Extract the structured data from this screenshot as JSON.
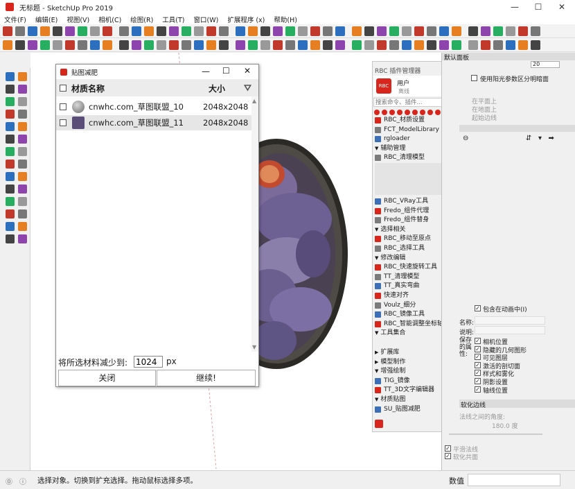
{
  "window": {
    "title": "无标题 - SketchUp Pro 2019",
    "minimize": "—",
    "maximize": "☐",
    "close": "✕"
  },
  "menu": [
    "文件(F)",
    "编辑(E)",
    "视图(V)",
    "相机(C)",
    "绘图(R)",
    "工具(T)",
    "窗口(W)",
    "扩展程序 (x)",
    "帮助(H)"
  ],
  "dialog": {
    "title": "贴图减肥",
    "col_name": "材质名称",
    "col_size": "大小",
    "rows": [
      {
        "name": "cnwhc.com_草图联盟_10",
        "size": "2048x2048"
      },
      {
        "name": "cnwhc.com_草图联盟_11",
        "size": "2048x2048"
      }
    ],
    "reduce_label": "将所选材料减少到:",
    "reduce_value": "1024",
    "unit": "px",
    "close_btn": "关闭",
    "continue_btn": "继续!"
  },
  "rbc": {
    "title": "RBC 插件管理器",
    "user": "用户",
    "user_sub": "离线",
    "search_placeholder": "搜索命令、插件...",
    "items": [
      {
        "label": "RBC_材质设置",
        "kind": "item"
      },
      {
        "label": "FCT_ModelLibrary",
        "kind": "item"
      },
      {
        "label": "rgloader",
        "kind": "item"
      },
      {
        "label": "辅助管理",
        "kind": "section"
      },
      {
        "label": "RBC_清理模型",
        "kind": "item"
      },
      {
        "label": "RBC_VRay工具",
        "kind": "item"
      },
      {
        "label": "Fredo_组件代理",
        "kind": "item"
      },
      {
        "label": "Fredo_组件替身",
        "kind": "item"
      },
      {
        "label": "选择相关",
        "kind": "section"
      },
      {
        "label": "RBC_移动至原点",
        "kind": "item"
      },
      {
        "label": "RBC_选择工具",
        "kind": "item"
      },
      {
        "label": "修改编辑",
        "kind": "section"
      },
      {
        "label": "RBC_快速旋转工具",
        "kind": "item"
      },
      {
        "label": "TT_清理模型",
        "kind": "item"
      },
      {
        "label": "TT_真实弯曲",
        "kind": "item"
      },
      {
        "label": "快速对齐",
        "kind": "item"
      },
      {
        "label": "Voulz_细分",
        "kind": "item"
      },
      {
        "label": "RBC_镜像工具",
        "kind": "item"
      },
      {
        "label": "RBC_智能调整坐标轴...",
        "kind": "item"
      },
      {
        "label": "工具集合",
        "kind": "section"
      },
      {
        "label": "扩展库",
        "kind": "collapsed"
      },
      {
        "label": "模型制作",
        "kind": "collapsed"
      },
      {
        "label": "增强绘制",
        "kind": "section"
      },
      {
        "label": "TIG_镜像",
        "kind": "item"
      },
      {
        "label": "TT_3D文字编辑器",
        "kind": "item"
      },
      {
        "label": "材质贴图",
        "kind": "section"
      },
      {
        "label": "SU_贴图减肥",
        "kind": "item"
      }
    ]
  },
  "tray": {
    "title": "默认面板",
    "shadow_value": "20",
    "use_sun": "使用阳光参数区分明暗面",
    "on_plane": "在平面上",
    "on_ground": "在地面上",
    "from_edges": "起始边线",
    "include_anim": "包含在动画中(I)",
    "name_label": "名称:",
    "desc_label": "说明:",
    "saved_props": "保存的属性:",
    "props": [
      "相机位置",
      "隐藏的几何图形",
      "可见图层",
      "激活的剖切面",
      "样式和雾化",
      "阴影设置",
      "轴线位置"
    ],
    "soften_title": "软化边线",
    "normal_angle": "法线之间的角度:",
    "angle_value": "180.0 度",
    "smooth": "平滑法线",
    "soften": "软化共面",
    "value_label": "数值"
  },
  "status": {
    "text": "选择对象。切换到扩充选择。拖动鼠标选择多项。"
  }
}
